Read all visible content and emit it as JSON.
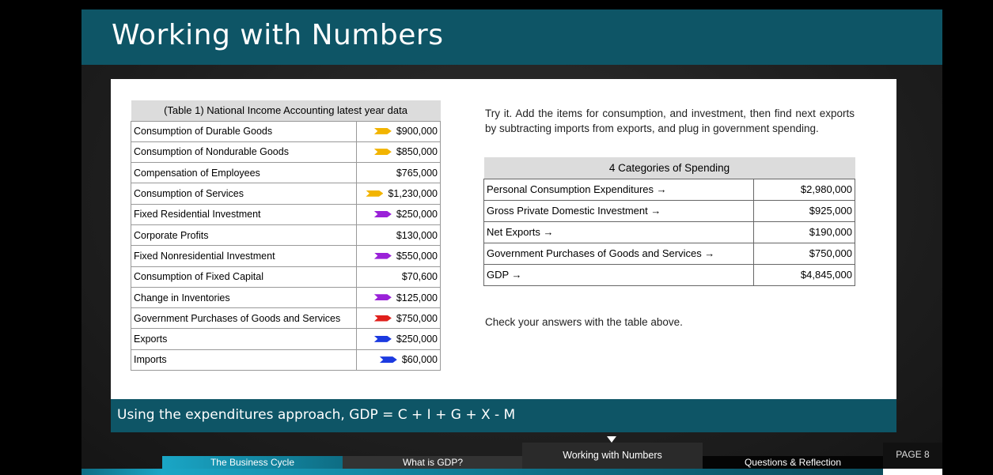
{
  "title": "Working with Numbers",
  "table1": {
    "caption": "(Table 1) National Income Accounting latest year data",
    "rows": [
      {
        "label": "Consumption of Durable Goods",
        "value": "$900,000",
        "arrow": "#f2b400"
      },
      {
        "label": "Consumption of Nondurable Goods",
        "value": "$850,000",
        "arrow": "#f2b400"
      },
      {
        "label": "Compensation of Employees",
        "value": "$765,000",
        "arrow": ""
      },
      {
        "label": "Consumption of Services",
        "value": "$1,230,000",
        "arrow": "#f2b400"
      },
      {
        "label": "Fixed Residential Investment",
        "value": "$250,000",
        "arrow": "#9a22d8"
      },
      {
        "label": "Corporate Profits",
        "value": "$130,000",
        "arrow": ""
      },
      {
        "label": "Fixed Nonresidential Investment",
        "value": "$550,000",
        "arrow": "#9a22d8"
      },
      {
        "label": "Consumption of Fixed Capital",
        "value": "$70,600",
        "arrow": ""
      },
      {
        "label": "Change in Inventories",
        "value": "$125,000",
        "arrow": "#9a22d8"
      },
      {
        "label": "Government Purchases of Goods and Services",
        "value": "$750,000",
        "arrow": "#e0201c"
      },
      {
        "label": "Exports",
        "value": "$250,000",
        "arrow": "#1c3ae0"
      },
      {
        "label": "Imports",
        "value": "$60,000",
        "arrow": "#1c3ae0"
      }
    ]
  },
  "intro": "Try it. Add the items for consumption, and investment, then find next exports by subtracting imports from exports, and plug in government spending.",
  "table2": {
    "caption": "4 Categories of Spending",
    "rows": [
      {
        "label": "Personal Consumption Expenditures →",
        "value": "$2,980,000"
      },
      {
        "label": "Gross Private Domestic Investment →",
        "value": "$925,000"
      },
      {
        "label": "Net Exports →",
        "value": "$190,000"
      },
      {
        "label": "Government Purchases of Goods and Services →",
        "value": "$750,000"
      },
      {
        "label": "GDP →",
        "value": "$4,845,000"
      }
    ]
  },
  "check": "Check your answers with the table above.",
  "formula": "Using the expenditures approach,  GDP = C + I + G + X - M",
  "nav": {
    "tabs": [
      "The Business Cycle",
      "What is GDP?",
      "Working with Numbers",
      "Questions & Reflection"
    ],
    "page": "PAGE 8"
  },
  "colors": {
    "header": "#0e5566",
    "accent": "#1aa6c6"
  }
}
